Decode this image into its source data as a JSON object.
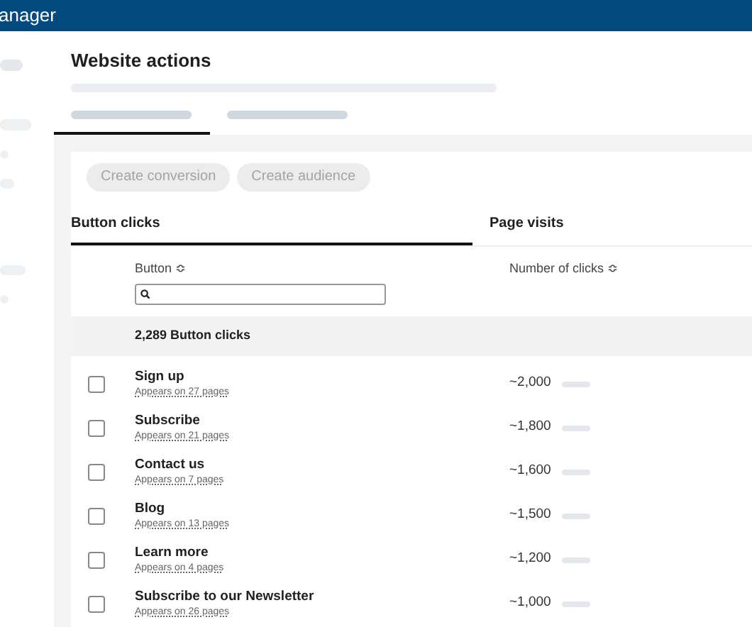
{
  "app_bar": {
    "title": "anager"
  },
  "page": {
    "title": "Website actions"
  },
  "page_tabs": [
    {
      "selected": true
    },
    {
      "selected": false
    }
  ],
  "actions": [
    {
      "label": "Create conversion",
      "disabled": true
    },
    {
      "label": "Create audience",
      "disabled": true
    }
  ],
  "tabs": [
    {
      "label": "Button clicks",
      "selected": true
    },
    {
      "label": "Page visits",
      "selected": false
    }
  ],
  "table": {
    "columns": [
      {
        "label": "Button",
        "sort_icon": "≎"
      },
      {
        "label": "Number of clicks",
        "sort_icon": "≎"
      }
    ],
    "summary": "2,289 Button clicks",
    "rows": [
      {
        "name": "Sign up",
        "detail": "Appears on 27 pages",
        "clicks": "~2,000",
        "checked": false
      },
      {
        "name": "Subscribe",
        "detail": "Appears on 21 pages",
        "clicks": "~1,800",
        "checked": false
      },
      {
        "name": "Contact us",
        "detail": "Appears on 7 pages",
        "clicks": "~1,600",
        "checked": false
      },
      {
        "name": "Blog",
        "detail": "Appears on 13 pages",
        "clicks": "~1,500",
        "checked": false
      },
      {
        "name": "Learn more",
        "detail": "Appears on 4 pages",
        "clicks": "~1,200",
        "checked": false
      },
      {
        "name": "Subscribe to our Newsletter",
        "detail": "Appears on 26 pages",
        "clicks": "~1,000",
        "checked": false
      }
    ]
  }
}
